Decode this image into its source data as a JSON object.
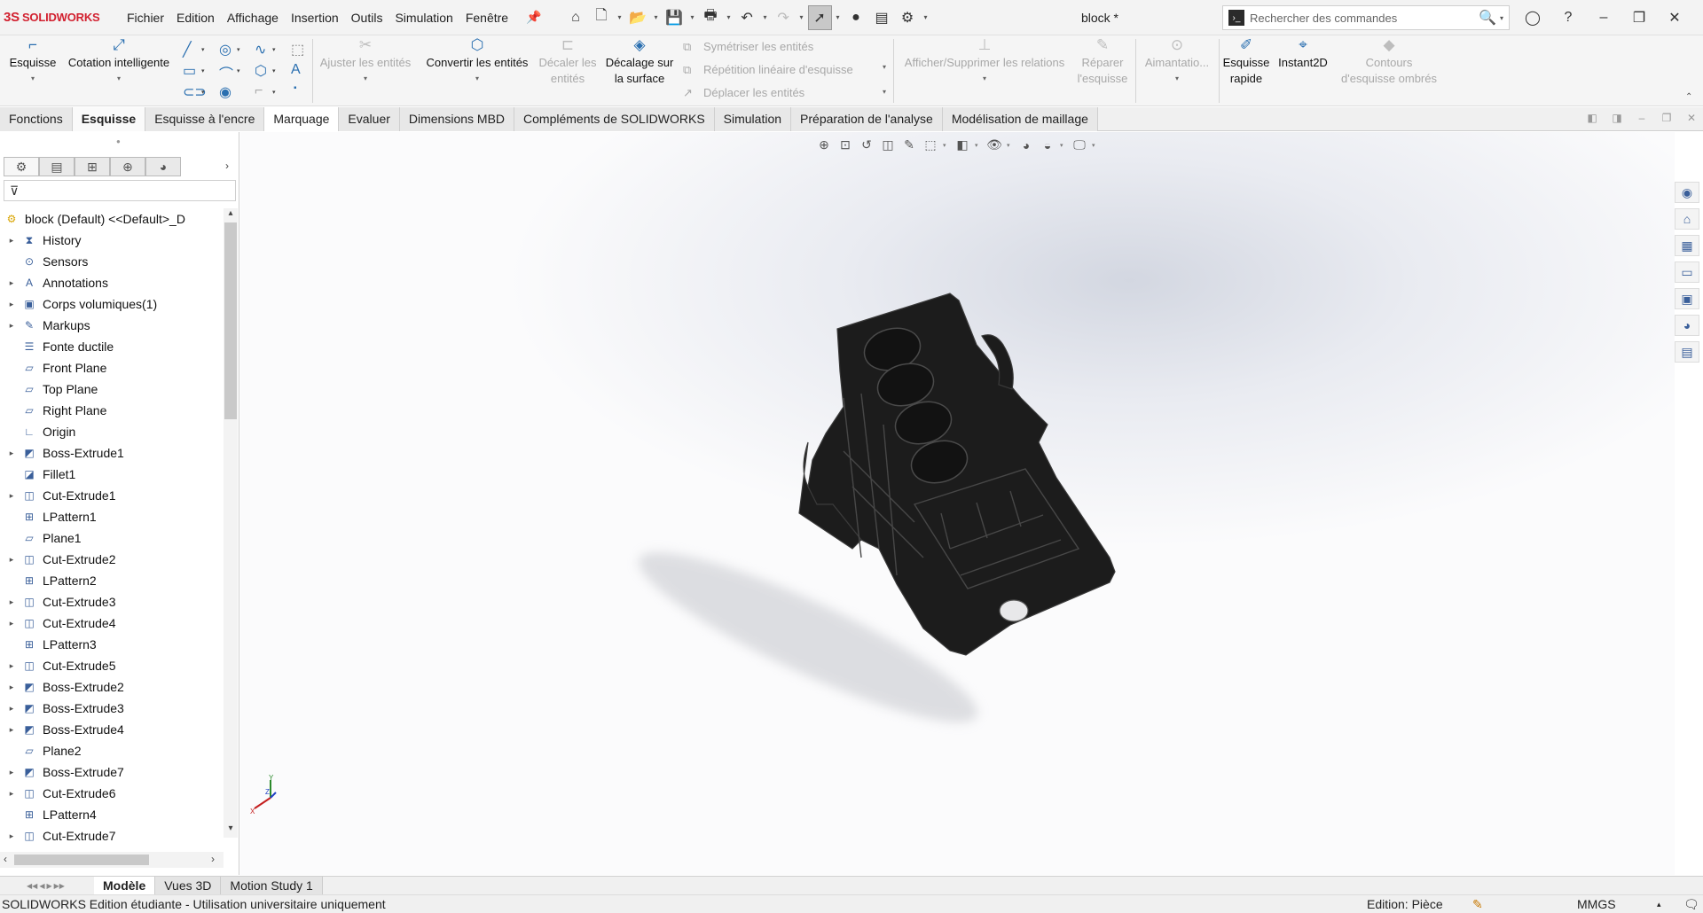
{
  "app": {
    "brand": "SOLIDWORKS",
    "document_title": "block *"
  },
  "menu": [
    "Fichier",
    "Edition",
    "Affichage",
    "Insertion",
    "Outils",
    "Simulation",
    "Fenêtre"
  ],
  "search": {
    "placeholder": "Rechercher des commandes"
  },
  "ribbon": {
    "esquisse": "Esquisse",
    "cotation": "Cotation intelligente",
    "ajuster": "Ajuster les entités",
    "convertir": "Convertir les entités",
    "decaler_1": "Décaler les",
    "decaler_2": "entités",
    "decalage_1": "Décalage sur",
    "decalage_2": "la surface",
    "symetriser": "Symétriser les entités",
    "repetition": "Répétition linéaire d'esquisse",
    "deplacer": "Déplacer les entités",
    "relations": "Afficher/Supprimer les relations",
    "reparer_1": "Réparer",
    "reparer_2": "l'esquisse",
    "aimantation": "Aimantatio...",
    "rapide_1": "Esquisse",
    "rapide_2": "rapide",
    "instant2d": "Instant2D",
    "contours_1": "Contours",
    "contours_2": "d'esquisse ombrés"
  },
  "tabs": [
    "Fonctions",
    "Esquisse",
    "Esquisse à l'encre",
    "Marquage",
    "Evaluer",
    "Dimensions MBD",
    "Compléments de SOLIDWORKS",
    "Simulation",
    "Préparation de l'analyse",
    "Modélisation de maillage"
  ],
  "active_tab": "Esquisse",
  "tree": {
    "root": "block (Default) <<Default>_D",
    "items": [
      {
        "label": "History",
        "icon": "history-icon",
        "expandable": true
      },
      {
        "label": "Sensors",
        "icon": "sensors-icon",
        "expandable": false
      },
      {
        "label": "Annotations",
        "icon": "annotations-icon",
        "expandable": true
      },
      {
        "label": "Corps volumiques(1)",
        "icon": "solid-bodies-icon",
        "expandable": true
      },
      {
        "label": "Markups",
        "icon": "markups-icon",
        "expandable": true
      },
      {
        "label": "Fonte ductile",
        "icon": "material-icon",
        "expandable": false
      },
      {
        "label": "Front Plane",
        "icon": "plane-icon",
        "expandable": false
      },
      {
        "label": "Top Plane",
        "icon": "plane-icon",
        "expandable": false
      },
      {
        "label": "Right Plane",
        "icon": "plane-icon",
        "expandable": false
      },
      {
        "label": "Origin",
        "icon": "origin-icon",
        "expandable": false
      },
      {
        "label": "Boss-Extrude1",
        "icon": "boss-extrude-icon",
        "expandable": true
      },
      {
        "label": "Fillet1",
        "icon": "fillet-icon",
        "expandable": false
      },
      {
        "label": "Cut-Extrude1",
        "icon": "cut-extrude-icon",
        "expandable": true
      },
      {
        "label": "LPattern1",
        "icon": "linear-pattern-icon",
        "expandable": false
      },
      {
        "label": "Plane1",
        "icon": "plane-icon",
        "expandable": false
      },
      {
        "label": "Cut-Extrude2",
        "icon": "cut-extrude-icon",
        "expandable": true
      },
      {
        "label": "LPattern2",
        "icon": "linear-pattern-icon",
        "expandable": false
      },
      {
        "label": "Cut-Extrude3",
        "icon": "cut-extrude-icon",
        "expandable": true
      },
      {
        "label": "Cut-Extrude4",
        "icon": "cut-extrude-icon",
        "expandable": true
      },
      {
        "label": "LPattern3",
        "icon": "linear-pattern-icon",
        "expandable": false
      },
      {
        "label": "Cut-Extrude5",
        "icon": "cut-extrude-icon",
        "expandable": true
      },
      {
        "label": "Boss-Extrude2",
        "icon": "boss-extrude-icon",
        "expandable": true
      },
      {
        "label": "Boss-Extrude3",
        "icon": "boss-extrude-icon",
        "expandable": true
      },
      {
        "label": "Boss-Extrude4",
        "icon": "boss-extrude-icon",
        "expandable": true
      },
      {
        "label": "Plane2",
        "icon": "plane-icon",
        "expandable": false
      },
      {
        "label": "Boss-Extrude7",
        "icon": "boss-extrude-icon",
        "expandable": true
      },
      {
        "label": "Cut-Extrude6",
        "icon": "cut-extrude-icon",
        "expandable": true
      },
      {
        "label": "LPattern4",
        "icon": "linear-pattern-icon",
        "expandable": false
      },
      {
        "label": "Cut-Extrude7",
        "icon": "cut-extrude-icon",
        "expandable": true
      }
    ]
  },
  "bottom_tabs": [
    "Modèle",
    "Vues 3D",
    "Motion Study 1"
  ],
  "active_bottom_tab": "Modèle",
  "status": {
    "left": "SOLIDWORKS Edition étudiante - Utilisation universitaire uniquement",
    "mode": "Edition: Pièce",
    "units": "MMGS"
  },
  "colors": {
    "brand": "#d2202f",
    "model": "#1c1c1c",
    "accent": "#2a6fb0"
  }
}
